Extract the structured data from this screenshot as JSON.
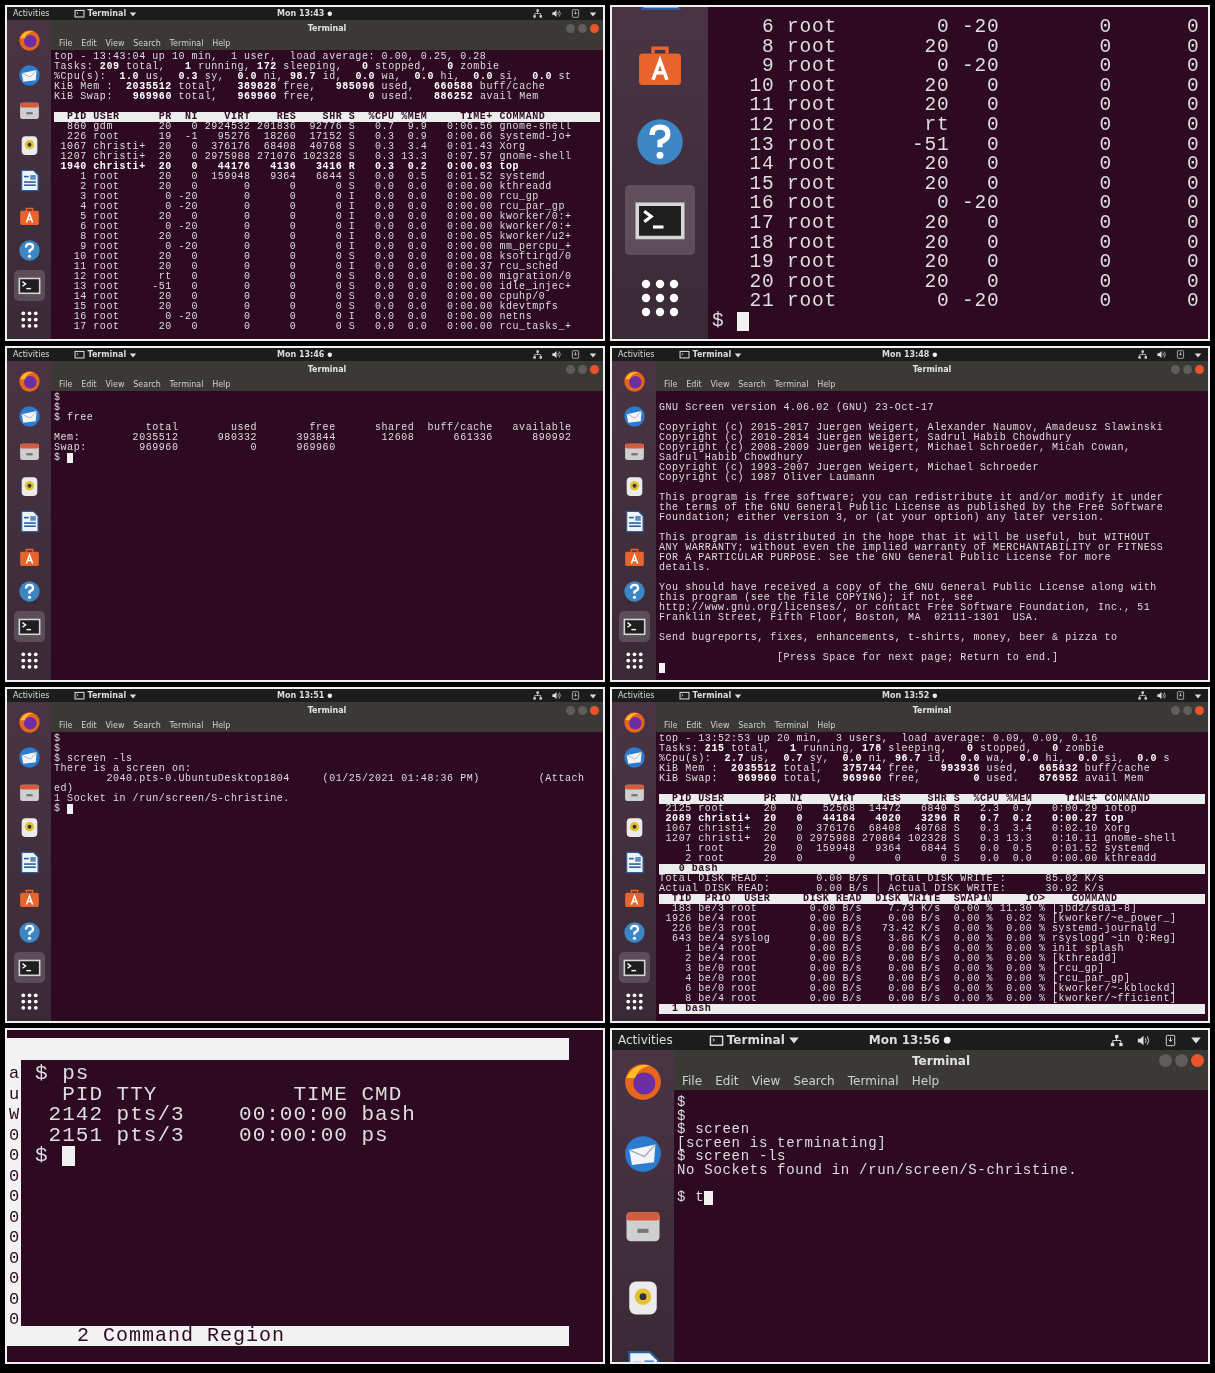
{
  "panels": [
    {
      "kind": "desktop",
      "top_bar": {
        "activities": "Activities",
        "app": "Terminal",
        "clock": "Mon 13:43"
      },
      "window_title": "Terminal",
      "menu": [
        "File",
        "Edit",
        "View",
        "Search",
        "Terminal",
        "Help"
      ],
      "lines": [
        {
          "kind": "text",
          "text": "top - 13:43:04 up 10 min,  1 user,  load average: 0.00, 0.25, 0.28"
        },
        {
          "kind": "text",
          "text": "Tasks: **209** total,   **1** running, **172** sleeping,   **0** stopped,   **0** zombie"
        },
        {
          "kind": "text",
          "text": "%Cpu(s):  **1.0** us,  **0.3** sy,  **0.0** ni, **98.7** id,  **0.0** wa,  **0.0** hi,  **0.0** si,  **0.0** st"
        },
        {
          "kind": "text",
          "text": "KiB Mem :  **2035512** total,   **389828** free,   **985096** used,   **660588** buff/cache"
        },
        {
          "kind": "text",
          "text": "KiB Swap:   **969960** total,   **969960** free,        **0** used.   **886252** avail Mem"
        },
        {
          "kind": "blank"
        },
        {
          "kind": "bar",
          "text": "  PID USER      PR  NI    VIRT    RES    SHR S  %CPU %MEM     TIME+ COMMAND"
        },
        {
          "kind": "text",
          "text": "  860 gdm       20   0 2924532 201836  92776 S   0.7  9.9   0:06.56 gnome-shell"
        },
        {
          "kind": "text",
          "text": "  226 root      19  -1   95276  18260  17152 S   0.3  0.9   0:00.66 systemd-jo+"
        },
        {
          "kind": "text",
          "text": " 1067 christi+  20   0  376176  68408  40768 S   0.3  3.4   0:01.43 Xorg"
        },
        {
          "kind": "text",
          "text": " 1207 christi+  20   0 2975988 271076 102328 S   0.3 13.3   0:07.57 gnome-shell"
        },
        {
          "kind": "bold",
          "text": " 1940 christi+  20   0   44176   4136   3416 R   0.3  0.2   0:00.03 top"
        },
        {
          "kind": "text",
          "text": "    1 root      20   0  159948   9364   6844 S   0.0  0.5   0:01.52 systemd"
        },
        {
          "kind": "text",
          "text": "    2 root      20   0       0      0      0 S   0.0  0.0   0:00.00 kthreadd"
        },
        {
          "kind": "text",
          "text": "    3 root       0 -20       0      0      0 I   0.0  0.0   0:00.00 rcu_gp"
        },
        {
          "kind": "text",
          "text": "    4 root       0 -20       0      0      0 I   0.0  0.0   0:00.00 rcu_par_gp"
        },
        {
          "kind": "text",
          "text": "    5 root      20   0       0      0      0 I   0.0  0.0   0:00.00 kworker/0:+"
        },
        {
          "kind": "text",
          "text": "    6 root       0 -20       0      0      0 I   0.0  0.0   0:00.00 kworker/0:+"
        },
        {
          "kind": "text",
          "text": "    8 root      20   0       0      0      0 I   0.0  0.0   0:00.05 kworker/u2+"
        },
        {
          "kind": "text",
          "text": "    9 root       0 -20       0      0      0 I   0.0  0.0   0:00.00 mm_percpu_+"
        },
        {
          "kind": "text",
          "text": "   10 root      20   0       0      0      0 S   0.0  0.0   0:00.08 ksoftirqd/0"
        },
        {
          "kind": "text",
          "text": "   11 root      20   0       0      0      0 I   0.0  0.0   0:00.37 rcu_sched"
        },
        {
          "kind": "text",
          "text": "   12 root      rt   0       0      0      0 S   0.0  0.0   0:00.00 migration/0"
        },
        {
          "kind": "text",
          "text": "   13 root     -51   0       0      0      0 S   0.0  0.0   0:00.00 idle_injec+"
        },
        {
          "kind": "text",
          "text": "   14 root      20   0       0      0      0 S   0.0  0.0   0:00.00 cpuhp/0"
        },
        {
          "kind": "text",
          "text": "   15 root      20   0       0      0      0 S   0.0  0.0   0:00.00 kdevtmpfs"
        },
        {
          "kind": "text",
          "text": "   16 root       0 -20       0      0      0 I   0.0  0.0   0:00.00 netns"
        },
        {
          "kind": "text",
          "text": "   17 root      20   0       0      0      0 S   0.0  0.0   0:00.00 rcu_tasks_+"
        }
      ]
    },
    {
      "kind": "zoom_dock",
      "lines": [
        {
          "kind": "text",
          "text": "    6 root        0 -20        0      0"
        },
        {
          "kind": "text",
          "text": "    8 root       20   0        0      0"
        },
        {
          "kind": "text",
          "text": "    9 root        0 -20        0      0"
        },
        {
          "kind": "text",
          "text": "   10 root       20   0        0      0"
        },
        {
          "kind": "text",
          "text": "   11 root       20   0        0      0"
        },
        {
          "kind": "text",
          "text": "   12 root       rt   0        0      0"
        },
        {
          "kind": "text",
          "text": "   13 root      -51   0        0      0"
        },
        {
          "kind": "text",
          "text": "   14 root       20   0        0      0"
        },
        {
          "kind": "text",
          "text": "   15 root       20   0        0      0"
        },
        {
          "kind": "text",
          "text": "   16 root        0 -20        0      0"
        },
        {
          "kind": "text",
          "text": "   17 root       20   0        0      0"
        },
        {
          "kind": "text",
          "text": "   18 root       20   0        0      0"
        },
        {
          "kind": "text",
          "text": "   19 root       20   0        0      0"
        },
        {
          "kind": "text",
          "text": "   20 root       20   0        0      0"
        },
        {
          "kind": "text",
          "text": "   21 root        0 -20        0      0"
        },
        {
          "kind": "prompt",
          "text": "$ "
        }
      ]
    },
    {
      "kind": "desktop",
      "top_bar": {
        "activities": "Activities",
        "app": "Terminal",
        "clock": "Mon 13:46"
      },
      "window_title": "Terminal",
      "menu": [
        "File",
        "Edit",
        "View",
        "Search",
        "Terminal",
        "Help"
      ],
      "lines": [
        {
          "kind": "text",
          "text": "$"
        },
        {
          "kind": "text",
          "text": "$"
        },
        {
          "kind": "text",
          "text": "$ free"
        },
        {
          "kind": "text",
          "text": "              total        used        free      shared  buff/cache   available"
        },
        {
          "kind": "text",
          "text": "Mem:        2035512      980332      393844       12608      661336      890992"
        },
        {
          "kind": "text",
          "text": "Swap:        969960           0      969960"
        },
        {
          "kind": "prompt",
          "text": "$ "
        }
      ]
    },
    {
      "kind": "desktop",
      "top_bar": {
        "activities": "Activities",
        "app": "Terminal",
        "clock": "Mon 13:48"
      },
      "window_title": "Terminal",
      "menu": [
        "File",
        "Edit",
        "View",
        "Search",
        "Terminal",
        "Help"
      ],
      "lines": [
        {
          "kind": "blank"
        },
        {
          "kind": "text",
          "text": "GNU Screen version 4.06.02 (GNU) 23-Oct-17"
        },
        {
          "kind": "blank"
        },
        {
          "kind": "text",
          "text": "Copyright (c) 2015-2017 Juergen Weigert, Alexander Naumov, Amadeusz Slawinski"
        },
        {
          "kind": "text",
          "text": "Copyright (c) 2010-2014 Juergen Weigert, Sadrul Habib Chowdhury"
        },
        {
          "kind": "text",
          "text": "Copyright (c) 2008-2009 Juergen Weigert, Michael Schroeder, Micah Cowan,"
        },
        {
          "kind": "text",
          "text": "Sadrul Habib Chowdhury"
        },
        {
          "kind": "text",
          "text": "Copyright (c) 1993-2007 Juergen Weigert, Michael Schroeder"
        },
        {
          "kind": "text",
          "text": "Copyright (c) 1987 Oliver Laumann"
        },
        {
          "kind": "blank"
        },
        {
          "kind": "text",
          "text": "This program is free software; you can redistribute it and/or modify it under"
        },
        {
          "kind": "text",
          "text": "the terms of the GNU General Public License as published by the Free Software"
        },
        {
          "kind": "text",
          "text": "Foundation; either version 3, or (at your option) any later version."
        },
        {
          "kind": "blank"
        },
        {
          "kind": "text",
          "text": "This program is distributed in the hope that it will be useful, but WITHOUT"
        },
        {
          "kind": "text",
          "text": "ANY WARRANTY; without even the implied warranty of MERCHANTABILITY or FITNESS"
        },
        {
          "kind": "text",
          "text": "FOR A PARTICULAR PURPOSE. See the GNU General Public License for more"
        },
        {
          "kind": "text",
          "text": "details."
        },
        {
          "kind": "blank"
        },
        {
          "kind": "text",
          "text": "You should have received a copy of the GNU General Public License along with"
        },
        {
          "kind": "text",
          "text": "this program (see the file COPYING); if not, see"
        },
        {
          "kind": "text",
          "text": "http://www.gnu.org/licenses/, or contact Free Software Foundation, Inc., 51"
        },
        {
          "kind": "text",
          "text": "Franklin Street, Fifth Floor, Boston, MA  02111-1301  USA."
        },
        {
          "kind": "blank"
        },
        {
          "kind": "text",
          "text": "Send bugreports, fixes, enhancements, t-shirts, money, beer & pizza to"
        },
        {
          "kind": "blank"
        },
        {
          "kind": "text",
          "text": "                  [Press Space for next page; Return to end.]"
        },
        {
          "kind": "prompt"
        }
      ]
    },
    {
      "kind": "desktop",
      "top_bar": {
        "activities": "Activities",
        "app": "Terminal",
        "clock": "Mon 13:51"
      },
      "window_title": "Terminal",
      "menu": [
        "File",
        "Edit",
        "View",
        "Search",
        "Terminal",
        "Help"
      ],
      "lines": [
        {
          "kind": "text",
          "text": "$"
        },
        {
          "kind": "text",
          "text": "$"
        },
        {
          "kind": "text",
          "text": "$ screen -ls"
        },
        {
          "kind": "text",
          "text": "There is a screen on:"
        },
        {
          "kind": "text",
          "text": "        2040.pts-0.UbuntuDesktop1804     (01/25/2021 01:48:36 PM)         (Attach"
        },
        {
          "kind": "text",
          "text": "ed)"
        },
        {
          "kind": "text",
          "text": "1 Socket in /run/screen/S-christine."
        },
        {
          "kind": "prompt",
          "text": "$ "
        }
      ]
    },
    {
      "kind": "desktop",
      "top_bar": {
        "activities": "Activities",
        "app": "Terminal",
        "clock": "Mon 13:52"
      },
      "window_title": "Terminal",
      "menu": [
        "File",
        "Edit",
        "View",
        "Search",
        "Terminal",
        "Help"
      ],
      "lines": [
        {
          "kind": "text",
          "text": "top - 13:52:53 up 20 min,  3 users,  load average: 0.09, 0.09, 0.16"
        },
        {
          "kind": "text",
          "text": "Tasks: **215** total,   **1** running, **178** sleeping,   **0** stopped,   **0** zombie"
        },
        {
          "kind": "text",
          "text": "%Cpu(s):  **2.7** us,  **0.7** sy,  **0.0** ni, **96.7** id,  **0.0** wa,  **0.0** hi,  **0.0** si,  **0.0** s"
        },
        {
          "kind": "text",
          "text": "KiB Mem :  **2035512** total,   **375744** free,   **993936** used,   **665832** buff/cache"
        },
        {
          "kind": "text",
          "text": "KiB Swap:   **969960** total,   **969960** free,        **0** used.   **876952** avail Mem"
        },
        {
          "kind": "blank"
        },
        {
          "kind": "bar",
          "text": "  PID USER      PR  NI    VIRT    RES    SHR S  %CPU %MEM     TIME+ COMMAND"
        },
        {
          "kind": "text",
          "text": " 2125 root      20   0   52568  14472   6840 S   2.3  0.7   0:00.29 iotop"
        },
        {
          "kind": "bold",
          "text": " 2089 christi+  20   0   44184   4020   3296 R   0.7  0.2   0:00.27 top"
        },
        {
          "kind": "text",
          "text": " 1067 christi+  20   0  376176  68408  40768 S   0.3  3.4   0:02.10 Xorg"
        },
        {
          "kind": "text",
          "text": " 1207 christi+  20   0 2975988 270864 102328 S   0.3 13.3   0:10.11 gnome-shell"
        },
        {
          "kind": "text",
          "text": "    1 root      20   0  159948   9364   6844 S   0.0  0.5   0:01.52 systemd"
        },
        {
          "kind": "text",
          "text": "    2 root      20   0       0      0      0 S   0.0  0.0   0:00.00 kthreadd"
        },
        {
          "kind": "bar",
          "text": "   0 bash"
        },
        {
          "kind": "text",
          "text": "Total DISK READ :       0.00 B/s | Total DISK WRITE :      85.02 K/s"
        },
        {
          "kind": "text",
          "text": "Actual DISK READ:       0.00 B/s | Actual DISK WRITE:      30.92 K/s"
        },
        {
          "kind": "bar",
          "text": "  TID  PRIO  USER     DISK READ  DISK WRITE  SWAPIN     IO>    COMMAND"
        },
        {
          "kind": "text",
          "text": "  183 be/3 root        0.00 B/s    7.73 K/s  0.00 % 11.30 % [jbd2/sda1-8]"
        },
        {
          "kind": "text",
          "text": " 1926 be/4 root        0.00 B/s    0.00 B/s  0.00 %  0.02 % [kworker/~e_power_]"
        },
        {
          "kind": "text",
          "text": "  226 be/3 root        0.00 B/s   73.42 K/s  0.00 %  0.00 % systemd-journald"
        },
        {
          "kind": "text",
          "text": "  643 be/4 syslog      0.00 B/s    3.86 K/s  0.00 %  0.00 % rsyslogd ~in Q:Reg]"
        },
        {
          "kind": "text",
          "text": "    1 be/4 root        0.00 B/s    0.00 B/s  0.00 %  0.00 % init splash"
        },
        {
          "kind": "text",
          "text": "    2 be/4 root        0.00 B/s    0.00 B/s  0.00 %  0.00 % [kthreadd]"
        },
        {
          "kind": "text",
          "text": "    3 be/0 root        0.00 B/s    0.00 B/s  0.00 %  0.00 % [rcu_gp]"
        },
        {
          "kind": "text",
          "text": "    4 be/0 root        0.00 B/s    0.00 B/s  0.00 %  0.00 % [rcu_par_gp]"
        },
        {
          "kind": "text",
          "text": "    6 be/0 root        0.00 B/s    0.00 B/s  0.00 %  0.00 % [kworker/~-kblockd]"
        },
        {
          "kind": "text",
          "text": "    8 be/4 root        0.00 B/s    0.00 B/s  0.00 %  0.00 % [kworker/~fficient]"
        },
        {
          "kind": "bar",
          "text": "  1 bash"
        }
      ]
    },
    {
      "kind": "zoom_screen",
      "side_column": [
        "a",
        "u",
        "W",
        "0",
        "0",
        "0",
        "0",
        "0",
        "0",
        "0",
        "0",
        "0",
        "0"
      ],
      "lines": [
        {
          "kind": "text",
          "text": "$ ps"
        },
        {
          "kind": "text",
          "text": "  PID TTY          TIME CMD"
        },
        {
          "kind": "text",
          "text": " 2142 pts/3    00:00:00 bash"
        },
        {
          "kind": "text",
          "text": " 2151 pts/3    00:00:00 ps"
        },
        {
          "kind": "prompt",
          "text": "$ "
        }
      ],
      "status": "2 Command Region"
    },
    {
      "kind": "desktop_large",
      "top_bar": {
        "activities": "Activities",
        "app": "Terminal",
        "clock": "Mon 13:56"
      },
      "window_title": "Terminal",
      "menu": [
        "File",
        "Edit",
        "View",
        "Search",
        "Terminal",
        "Help"
      ],
      "lines": [
        {
          "kind": "text",
          "text": "$"
        },
        {
          "kind": "text",
          "text": "$"
        },
        {
          "kind": "text",
          "text": "$ screen"
        },
        {
          "kind": "text",
          "text": "[screen is terminating]"
        },
        {
          "kind": "text",
          "text": "$ screen -ls"
        },
        {
          "kind": "text",
          "text": "No Sockets found in /run/screen/S-christine."
        },
        {
          "kind": "blank"
        },
        {
          "kind": "prompt",
          "text": "$ t"
        }
      ]
    }
  ]
}
